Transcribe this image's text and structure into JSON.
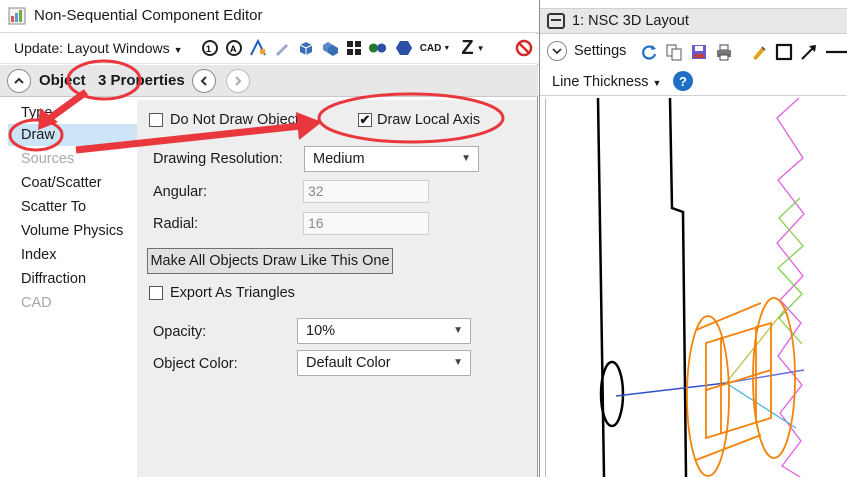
{
  "editor": {
    "title": "Non-Sequential Component Editor",
    "toolbar": {
      "update_label": "Update: Layout Windows",
      "cad_label": "CAD",
      "z_label": "Z"
    },
    "header": {
      "object_label": "Object",
      "properties_label": "3 Properties"
    },
    "nav_items": [
      {
        "label": "Type",
        "state": "normal"
      },
      {
        "label": "Draw",
        "state": "selected"
      },
      {
        "label": "Sources",
        "state": "disabled"
      },
      {
        "label": "Coat/Scatter",
        "state": "normal"
      },
      {
        "label": "Scatter To",
        "state": "normal"
      },
      {
        "label": "Volume Physics",
        "state": "normal"
      },
      {
        "label": "Index",
        "state": "normal"
      },
      {
        "label": "Diffraction",
        "state": "normal"
      },
      {
        "label": "CAD",
        "state": "disabled"
      }
    ],
    "draw": {
      "do_not_draw_label": "Do Not Draw Object",
      "do_not_draw_checked": false,
      "draw_local_axis_label": "Draw Local Axis",
      "draw_local_axis_checked": true,
      "drawing_resolution_label": "Drawing Resolution:",
      "drawing_resolution_value": "Medium",
      "angular_label": "Angular:",
      "angular_value": "32",
      "radial_label": "Radial:",
      "radial_value": "16",
      "make_all_button": "Make All Objects Draw Like This One",
      "export_triangles_label": "Export As Triangles",
      "export_triangles_checked": false,
      "opacity_label": "Opacity:",
      "opacity_value": "10%",
      "object_color_label": "Object Color:",
      "object_color_value": "Default Color",
      "check_mark": "✔"
    }
  },
  "layout_window": {
    "title": "1: NSC 3D Layout",
    "settings_label": "Settings",
    "line_thickness_label": "Line Thickness",
    "help_glyph": "?"
  },
  "colors": {
    "annotation": "#e8373d",
    "selection": "#cde4f7",
    "object_orange": "#f5820a",
    "ray_pink": "#e060e0",
    "ray_green": "#80d050"
  }
}
